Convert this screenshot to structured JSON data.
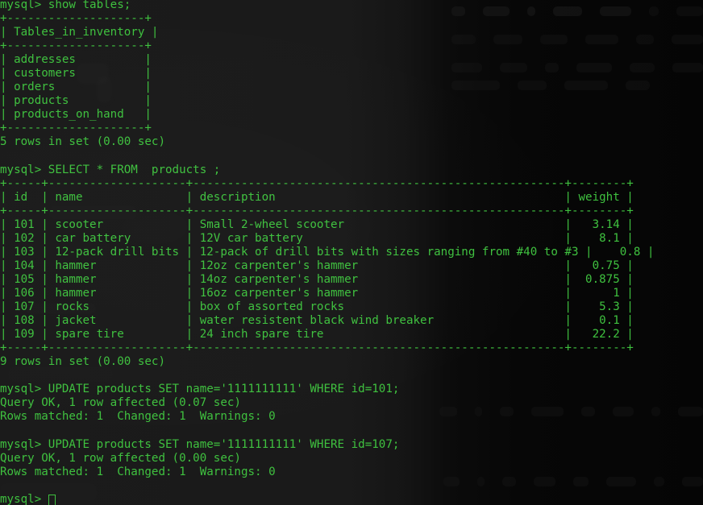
{
  "terminal": {
    "app": "mysql-client-terminal",
    "prompt": "mysql>",
    "cursor_glyph": "block-hollow",
    "text_color": "#3fc13f",
    "background_color": "#121212"
  },
  "commands": {
    "show_tables": "show tables;",
    "select_products": "SELECT * FROM  products ;",
    "update_101": "UPDATE products SET name='1111111111' WHERE id=101;",
    "update_107": "UPDATE products SET name='1111111111' WHERE id=107;"
  },
  "results": {
    "tables_result": {
      "header": "Tables_in_inventory",
      "rows": [
        "addresses",
        "customers",
        "orders",
        "products",
        "products_on_hand"
      ],
      "footer": "5 rows in set (0.00 sec)"
    },
    "products_result": {
      "columns": [
        "id",
        "name",
        "description",
        "weight"
      ],
      "rows": [
        [
          "101",
          "scooter",
          "Small 2-wheel scooter",
          "3.14"
        ],
        [
          "102",
          "car battery",
          "12V car battery",
          "8.1"
        ],
        [
          "103",
          "12-pack drill bits",
          "12-pack of drill bits with sizes ranging from #40 to #3",
          "0.8"
        ],
        [
          "104",
          "hammer",
          "12oz carpenter's hammer",
          "0.75"
        ],
        [
          "105",
          "hammer",
          "14oz carpenter's hammer",
          "0.875"
        ],
        [
          "106",
          "hammer",
          "16oz carpenter's hammer",
          "1"
        ],
        [
          "107",
          "rocks",
          "box of assorted rocks",
          "5.3"
        ],
        [
          "108",
          "jacket",
          "water resistent black wind breaker",
          "0.1"
        ],
        [
          "109",
          "spare tire",
          "24 inch spare tire",
          "22.2"
        ]
      ],
      "footer": "9 rows in set (0.00 sec)"
    },
    "update_101_result": {
      "status": "Query OK, 1 row affected (0.07 sec)",
      "detail": "Rows matched: 1  Changed: 1  Warnings: 0"
    },
    "update_107_result": {
      "status": "Query OK, 1 row affected (0.00 sec)",
      "detail": "Rows matched: 1  Changed: 1  Warnings: 0"
    }
  },
  "lines": [
    "mysql> show tables;",
    "+--------------------+",
    "| Tables_in_inventory |",
    "+--------------------+",
    "| addresses          |",
    "| customers          |",
    "| orders             |",
    "| products           |",
    "| products_on_hand   |",
    "+--------------------+",
    "5 rows in set (0.00 sec)",
    "",
    "mysql> SELECT * FROM  products ;",
    "+-----+--------------------+------------------------------------------------------+--------+",
    "| id  | name               | description                                          | weight |",
    "+-----+--------------------+------------------------------------------------------+--------+",
    "| 101 | scooter            | Small 2-wheel scooter                                |   3.14 |",
    "| 102 | car battery        | 12V car battery                                      |    8.1 |",
    "| 103 | 12-pack drill bits | 12-pack of drill bits with sizes ranging from #40 to #3 |    0.8 |",
    "| 104 | hammer             | 12oz carpenter's hammer                              |   0.75 |",
    "| 105 | hammer             | 14oz carpenter's hammer                              |  0.875 |",
    "| 106 | hammer             | 16oz carpenter's hammer                              |      1 |",
    "| 107 | rocks              | box of assorted rocks                                |    5.3 |",
    "| 108 | jacket             | water resistent black wind breaker                   |    0.1 |",
    "| 109 | spare tire         | 24 inch spare tire                                   |   22.2 |",
    "+-----+--------------------+------------------------------------------------------+--------+",
    "9 rows in set (0.00 sec)",
    "",
    "mysql> UPDATE products SET name='1111111111' WHERE id=101;",
    "Query OK, 1 row affected (0.07 sec)",
    "Rows matched: 1  Changed: 1  Warnings: 0",
    "",
    "mysql> UPDATE products SET name='1111111111' WHERE id=107;",
    "Query OK, 1 row affected (0.00 sec)",
    "Rows matched: 1  Changed: 1  Warnings: 0",
    "",
    "mysql> "
  ]
}
